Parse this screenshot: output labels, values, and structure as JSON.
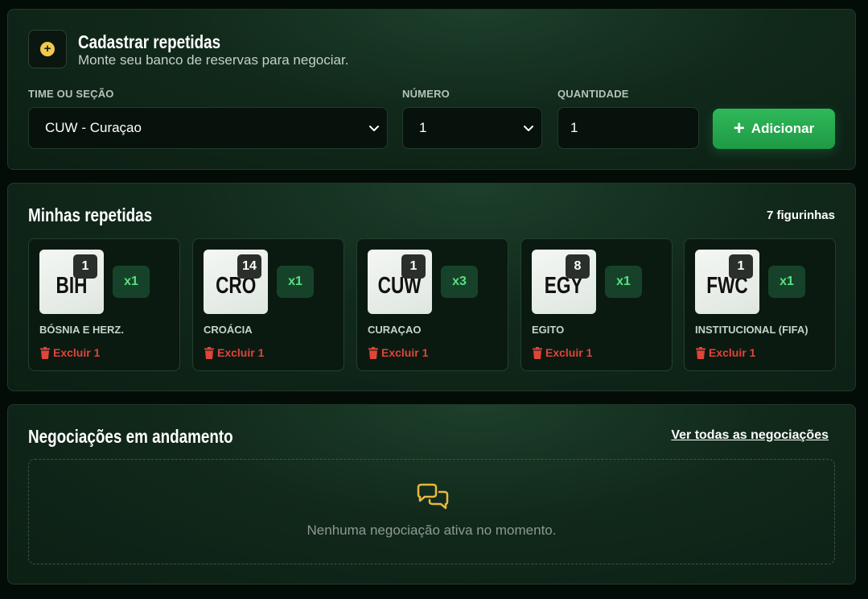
{
  "register": {
    "title": "Cadastrar repetidas",
    "subtitle": "Monte seu banco de reservas para negociar.",
    "team_label": "TIME OU SEÇÃO",
    "team_value": "CUW - Curaçao",
    "number_label": "NÚMERO",
    "number_value": "1",
    "quantity_label": "QUANTIDADE",
    "quantity_value": "1",
    "add_button": "Adicionar"
  },
  "duplicates": {
    "title": "Minhas repetidas",
    "count": "7 figurinhas",
    "cards": [
      {
        "code": "BIH",
        "number": "1",
        "qty": "x1",
        "name": "BÓSNIA E HERZ.",
        "delete": "Excluir 1"
      },
      {
        "code": "CRO",
        "number": "14",
        "qty": "x1",
        "name": "CROÁCIA",
        "delete": "Excluir 1"
      },
      {
        "code": "CUW",
        "number": "1",
        "qty": "x3",
        "name": "CURAÇAO",
        "delete": "Excluir 1"
      },
      {
        "code": "EGY",
        "number": "8",
        "qty": "x1",
        "name": "EGITO",
        "delete": "Excluir 1"
      },
      {
        "code": "FWC",
        "number": "1",
        "qty": "x1",
        "name": "INSTITUCIONAL (FIFA)",
        "delete": "Excluir 1"
      }
    ]
  },
  "negotiations": {
    "title": "Negociações em andamento",
    "view_all": "Ver todas as negociações",
    "empty_message": "Nenhuma negociação ativa no momento."
  },
  "colors": {
    "accent_green": "#22a84c",
    "danger_red": "#e0443a",
    "icon_yellow": "#f2c94c"
  }
}
